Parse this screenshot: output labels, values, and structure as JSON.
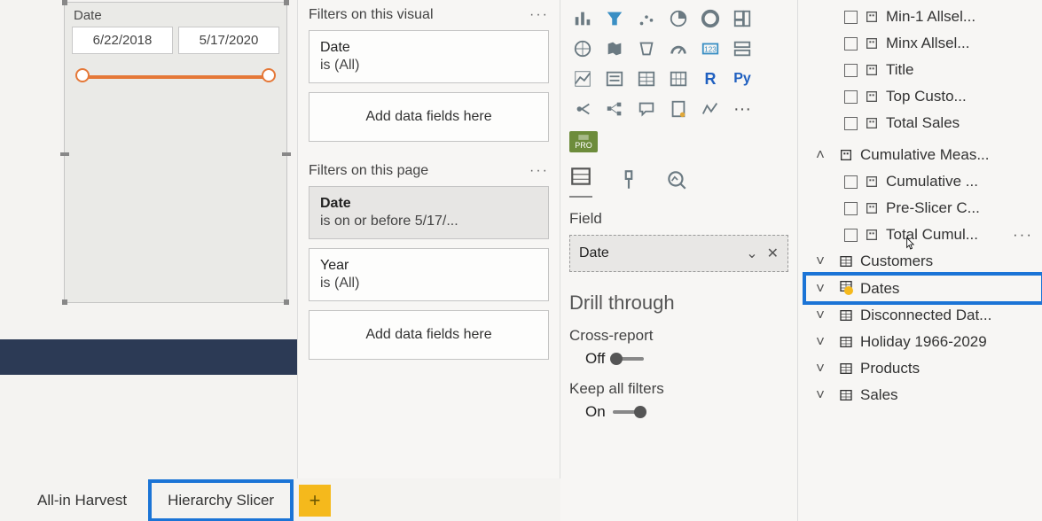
{
  "slicer": {
    "title": "Date",
    "date_from": "6/22/2018",
    "date_to": "5/17/2020"
  },
  "tabs": {
    "tab1": "All-in Harvest",
    "tab2": "Hierarchy Slicer"
  },
  "filters": {
    "visual_header": "Filters on this visual",
    "visual_card_name": "Date",
    "visual_card_cond": "is (All)",
    "drop_hint": "Add data fields here",
    "page_header": "Filters on this page",
    "page_card1_name": "Date",
    "page_card1_cond": "is on or before 5/17/...",
    "page_card2_name": "Year",
    "page_card2_cond": "is (All)"
  },
  "viz": {
    "pro": "PRO",
    "field_label": "Field",
    "field_value": "Date",
    "drill_header": "Drill through",
    "cross_label": "Cross-report",
    "cross_state": "Off",
    "keep_label": "Keep all filters",
    "keep_state": "On"
  },
  "fields": {
    "measures": {
      "m1": "Min-1 Allsel...",
      "m2": "Minx Allsel...",
      "m3": "Title",
      "m4": "Top Custo...",
      "m5": "Total Sales"
    },
    "cum_header": "Cumulative Meas...",
    "cum": {
      "c1": "Cumulative ...",
      "c2": "Pre-Slicer C...",
      "c3": "Total Cumul..."
    },
    "tables": {
      "t1": "Customers",
      "t2": "Dates",
      "t3": "Disconnected Dat...",
      "t4": "Holiday 1966-2029",
      "t5": "Products",
      "t6": "Sales"
    }
  }
}
